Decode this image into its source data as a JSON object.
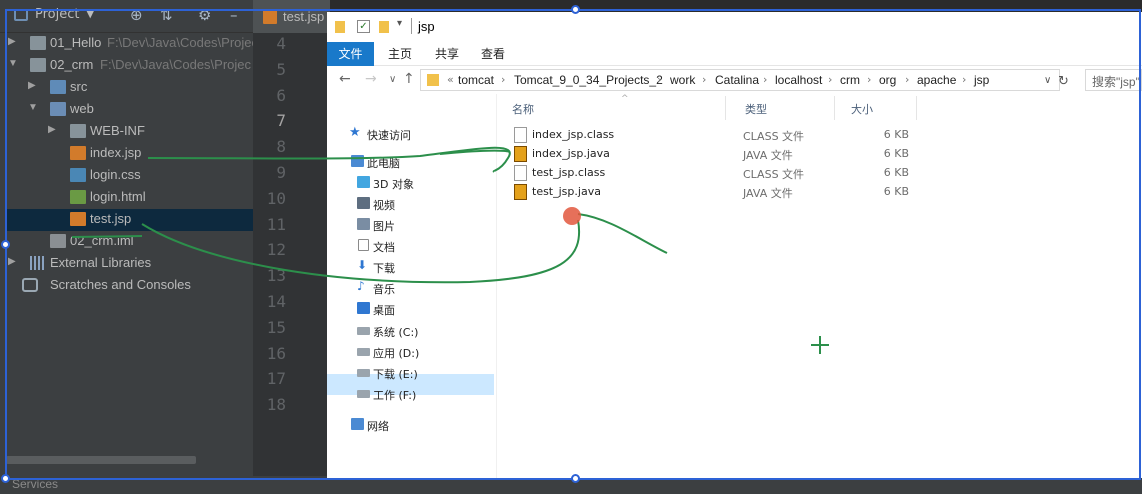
{
  "ide": {
    "panel_title": "Project",
    "tree": [
      {
        "label": "01_Hello",
        "path": "F:\\Dev\\Java\\Codes\\Projec"
      },
      {
        "label": "02_crm",
        "path": "F:\\Dev\\Java\\Codes\\Projec"
      },
      {
        "label": "src"
      },
      {
        "label": "web"
      },
      {
        "label": "WEB-INF"
      },
      {
        "label": "index.jsp"
      },
      {
        "label": "login.css"
      },
      {
        "label": "login.html"
      },
      {
        "label": "test.jsp"
      },
      {
        "label": "02_crm.iml"
      },
      {
        "label": "External Libraries"
      },
      {
        "label": "Scratches and Consoles"
      }
    ],
    "editor_tab": "test.jsp",
    "line_numbers": [
      "4",
      "5",
      "6",
      "7",
      "8",
      "9",
      "10",
      "11",
      "12",
      "13",
      "14",
      "15",
      "16",
      "17",
      "18"
    ],
    "current_line": "7",
    "bottom_tool": "Services"
  },
  "explorer": {
    "window_title": "jsp",
    "ribbon_tabs": [
      "文件",
      "主页",
      "共享",
      "查看"
    ],
    "breadcrumb": [
      "tomcat",
      "Tomcat_9_0_34_Projects_2",
      "work",
      "Catalina",
      "localhost",
      "crm",
      "org",
      "apache",
      "jsp"
    ],
    "breadcrumb_prefix": "«",
    "search_placeholder": "搜索\"jsp\"",
    "nav_items": [
      {
        "label": "快速访问",
        "icon": "star-icon"
      },
      {
        "label": "此电脑",
        "icon": "computer-icon"
      },
      {
        "label": "3D 对象",
        "icon": "cube-icon"
      },
      {
        "label": "视频",
        "icon": "video-icon"
      },
      {
        "label": "图片",
        "icon": "picture-icon"
      },
      {
        "label": "文档",
        "icon": "document-icon"
      },
      {
        "label": "下载",
        "icon": "download-icon"
      },
      {
        "label": "音乐",
        "icon": "music-icon"
      },
      {
        "label": "桌面",
        "icon": "desktop-icon"
      },
      {
        "label": "系统 (C:)",
        "icon": "drive-icon"
      },
      {
        "label": "应用 (D:)",
        "icon": "drive-icon"
      },
      {
        "label": "下载 (E:)",
        "icon": "drive-icon"
      },
      {
        "label": "工作 (F:)",
        "icon": "drive-icon"
      },
      {
        "label": "网络",
        "icon": "network-icon"
      }
    ],
    "columns": [
      "名称",
      "类型",
      "大小"
    ],
    "files": [
      {
        "name": "index_jsp.class",
        "type": "CLASS 文件",
        "size": "6 KB"
      },
      {
        "name": "index_jsp.java",
        "type": "JAVA 文件",
        "size": "6 KB"
      },
      {
        "name": "test_jsp.class",
        "type": "CLASS 文件",
        "size": "6 KB"
      },
      {
        "name": "test_jsp.java",
        "type": "JAVA 文件",
        "size": "6 KB"
      }
    ]
  },
  "colors": {
    "ide_bg": "#3c3f41",
    "accent_blue": "#1979ca",
    "annotation_green": "#2c8f4b",
    "selection_box": "#2d62d6"
  }
}
